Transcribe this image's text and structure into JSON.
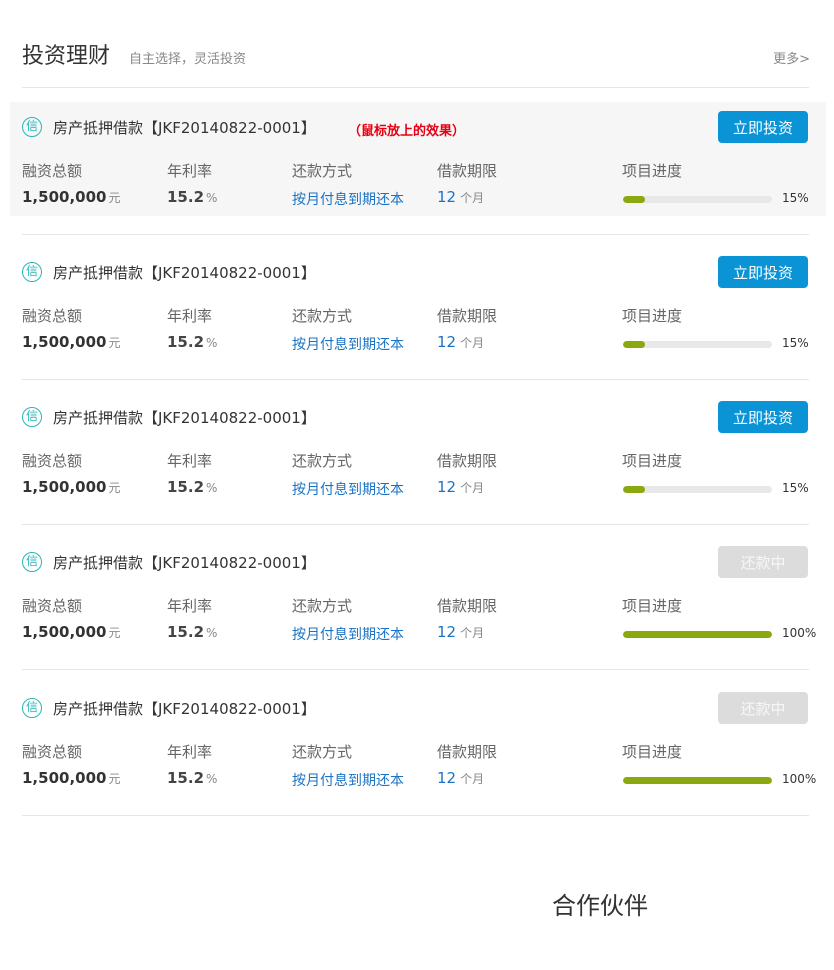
{
  "header": {
    "title": "投资理财",
    "subtitle": "自主选择，灵活投资",
    "more_label": "更多>"
  },
  "labels": {
    "amount": "融资总额",
    "rate": "年利率",
    "method": "还款方式",
    "term": "借款期限",
    "progress": "项目进度"
  },
  "loans": [
    {
      "badge": "信",
      "title": "房产抵押借款【JKF20140822-0001】",
      "note": "（鼠标放上的效果）",
      "amount": "1,500,000",
      "amount_unit": "元",
      "rate": "15.2",
      "rate_unit": "%",
      "method": "按月付息到期还本",
      "term": "12",
      "term_unit": "个月",
      "progress_percent": 15,
      "progress_label": "15%",
      "button_label": "立即投资",
      "button_enabled": true,
      "hover": true
    },
    {
      "badge": "信",
      "title": "房产抵押借款【JKF20140822-0001】",
      "note": "",
      "amount": "1,500,000",
      "amount_unit": "元",
      "rate": "15.2",
      "rate_unit": "%",
      "method": "按月付息到期还本",
      "term": "12",
      "term_unit": "个月",
      "progress_percent": 15,
      "progress_label": "15%",
      "button_label": "立即投资",
      "button_enabled": true,
      "hover": false
    },
    {
      "badge": "信",
      "title": "房产抵押借款【JKF20140822-0001】",
      "note": "",
      "amount": "1,500,000",
      "amount_unit": "元",
      "rate": "15.2",
      "rate_unit": "%",
      "method": "按月付息到期还本",
      "term": "12",
      "term_unit": "个月",
      "progress_percent": 15,
      "progress_label": "15%",
      "button_label": "立即投资",
      "button_enabled": true,
      "hover": false
    },
    {
      "badge": "信",
      "title": "房产抵押借款【JKF20140822-0001】",
      "note": "",
      "amount": "1,500,000",
      "amount_unit": "元",
      "rate": "15.2",
      "rate_unit": "%",
      "method": "按月付息到期还本",
      "term": "12",
      "term_unit": "个月",
      "progress_percent": 100,
      "progress_label": "100%",
      "button_label": "还款中",
      "button_enabled": false,
      "hover": false
    },
    {
      "badge": "信",
      "title": "房产抵押借款【JKF20140822-0001】",
      "note": "",
      "amount": "1,500,000",
      "amount_unit": "元",
      "rate": "15.2",
      "rate_unit": "%",
      "method": "按月付息到期还本",
      "term": "12",
      "term_unit": "个月",
      "progress_percent": 100,
      "progress_label": "100%",
      "button_label": "还款中",
      "button_enabled": false,
      "hover": false
    }
  ],
  "partners": {
    "title": "合作伙伴"
  },
  "colors": {
    "accent_blue": "#0a93d5",
    "link_blue": "#1a73c4",
    "progress_green": "#8aa810",
    "badge_teal": "#29b6b6",
    "hover_note_red": "#e60012",
    "disabled_gray": "#dcdcdc"
  }
}
